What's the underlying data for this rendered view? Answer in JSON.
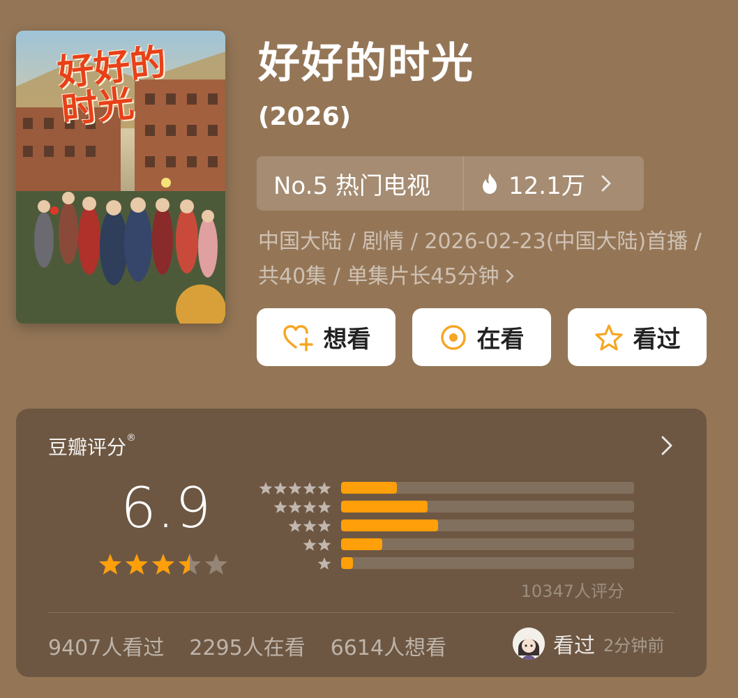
{
  "poster": {
    "title_art": "好好的时光"
  },
  "title": "好好的时光",
  "year": "(2026)",
  "rank": {
    "label": "No.5 热门电视",
    "heat": "12.1万"
  },
  "meta": "中国大陆 / 剧情 / 2026-02-23(中国大陆)首播 / 共40集 / 单集片长45分钟",
  "actions": [
    {
      "label": "想看",
      "icon": "heart-plus-icon"
    },
    {
      "label": "在看",
      "icon": "target-icon"
    },
    {
      "label": "看过",
      "icon": "star-outline-icon"
    }
  ],
  "rating": {
    "title": "豆瓣评分",
    "registered": "®",
    "score": "6.9",
    "stars": 3.5,
    "distribution": [
      {
        "stars": 5,
        "fraction": 0.19
      },
      {
        "stars": 4,
        "fraction": 0.295
      },
      {
        "stars": 3,
        "fraction": 0.33
      },
      {
        "stars": 2,
        "fraction": 0.14
      },
      {
        "stars": 1,
        "fraction": 0.04
      }
    ],
    "count": "10347人评分"
  },
  "stats": {
    "watched": "9407人看过",
    "watching": "2295人在看",
    "want": "6614人想看"
  },
  "recent": {
    "label": "看过",
    "time": "2分钟前"
  },
  "colors": {
    "background": "#947657",
    "panel": "#6d5742",
    "accent": "#ff9f0a",
    "icon_orange": "#f5a623"
  }
}
